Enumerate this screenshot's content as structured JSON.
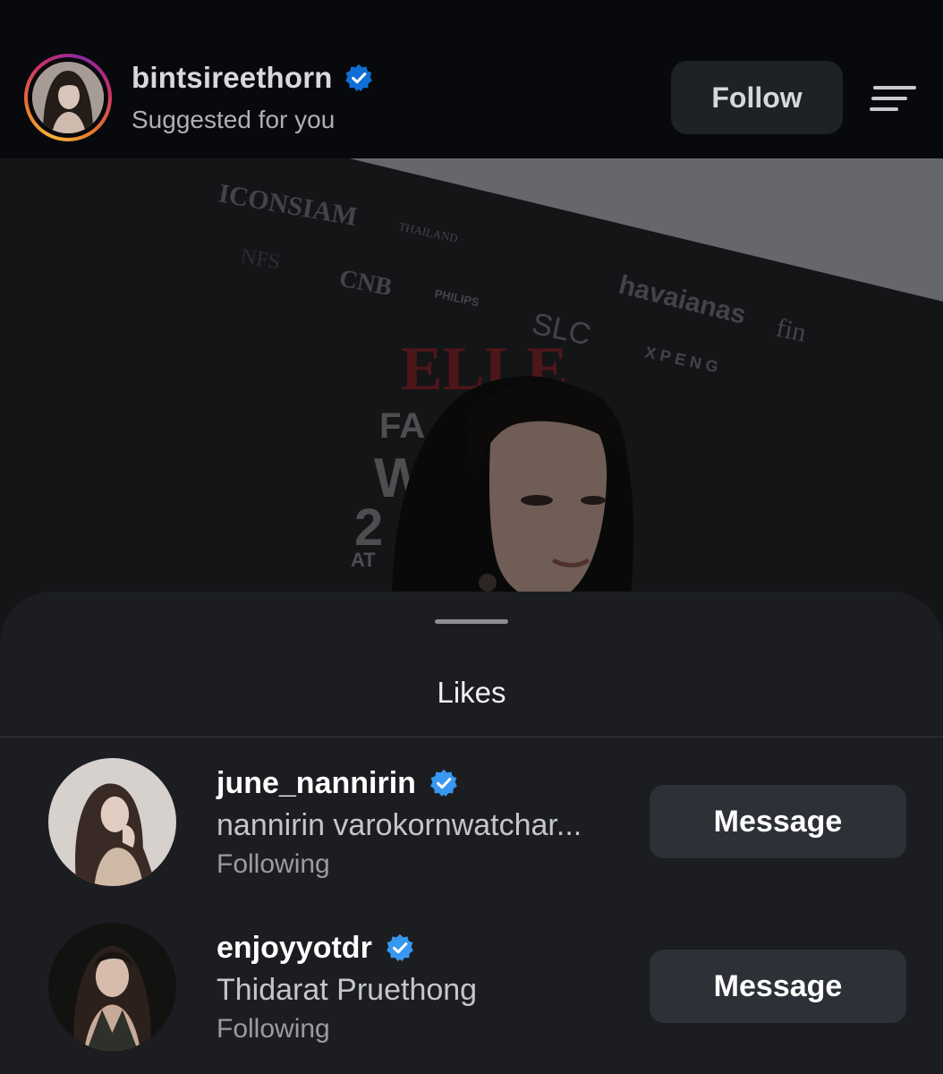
{
  "post": {
    "author": {
      "username": "bintsireethorn",
      "verified": true,
      "subtitle": "Suggested for you",
      "avatar_icon": "profile-photo"
    },
    "follow_label": "Follow",
    "menu_icon": "hamburger-menu-icon",
    "backdrop_logos": [
      "ICONSIAM",
      "THAILAND",
      "NFS",
      "CNB",
      "PHILIPS",
      "SLC",
      "havaianas",
      "fin",
      "XPENG",
      "ELLE",
      "FA",
      "W",
      "2",
      "AT"
    ]
  },
  "likes_sheet": {
    "title": "Likes",
    "users": [
      {
        "username": "june_nannirin",
        "verified": true,
        "full_name": "nannirin varokornwatchar...",
        "status": "Following",
        "action_label": "Message"
      },
      {
        "username": "enjoyyotdr",
        "verified": true,
        "full_name": "Thidarat Pruethong",
        "status": "Following",
        "action_label": "Message"
      }
    ]
  },
  "colors": {
    "verified_blue": "#3897f0",
    "sheet_background": "#1b1d21",
    "button_background": "#2d3037",
    "header_background": "#08090c"
  }
}
